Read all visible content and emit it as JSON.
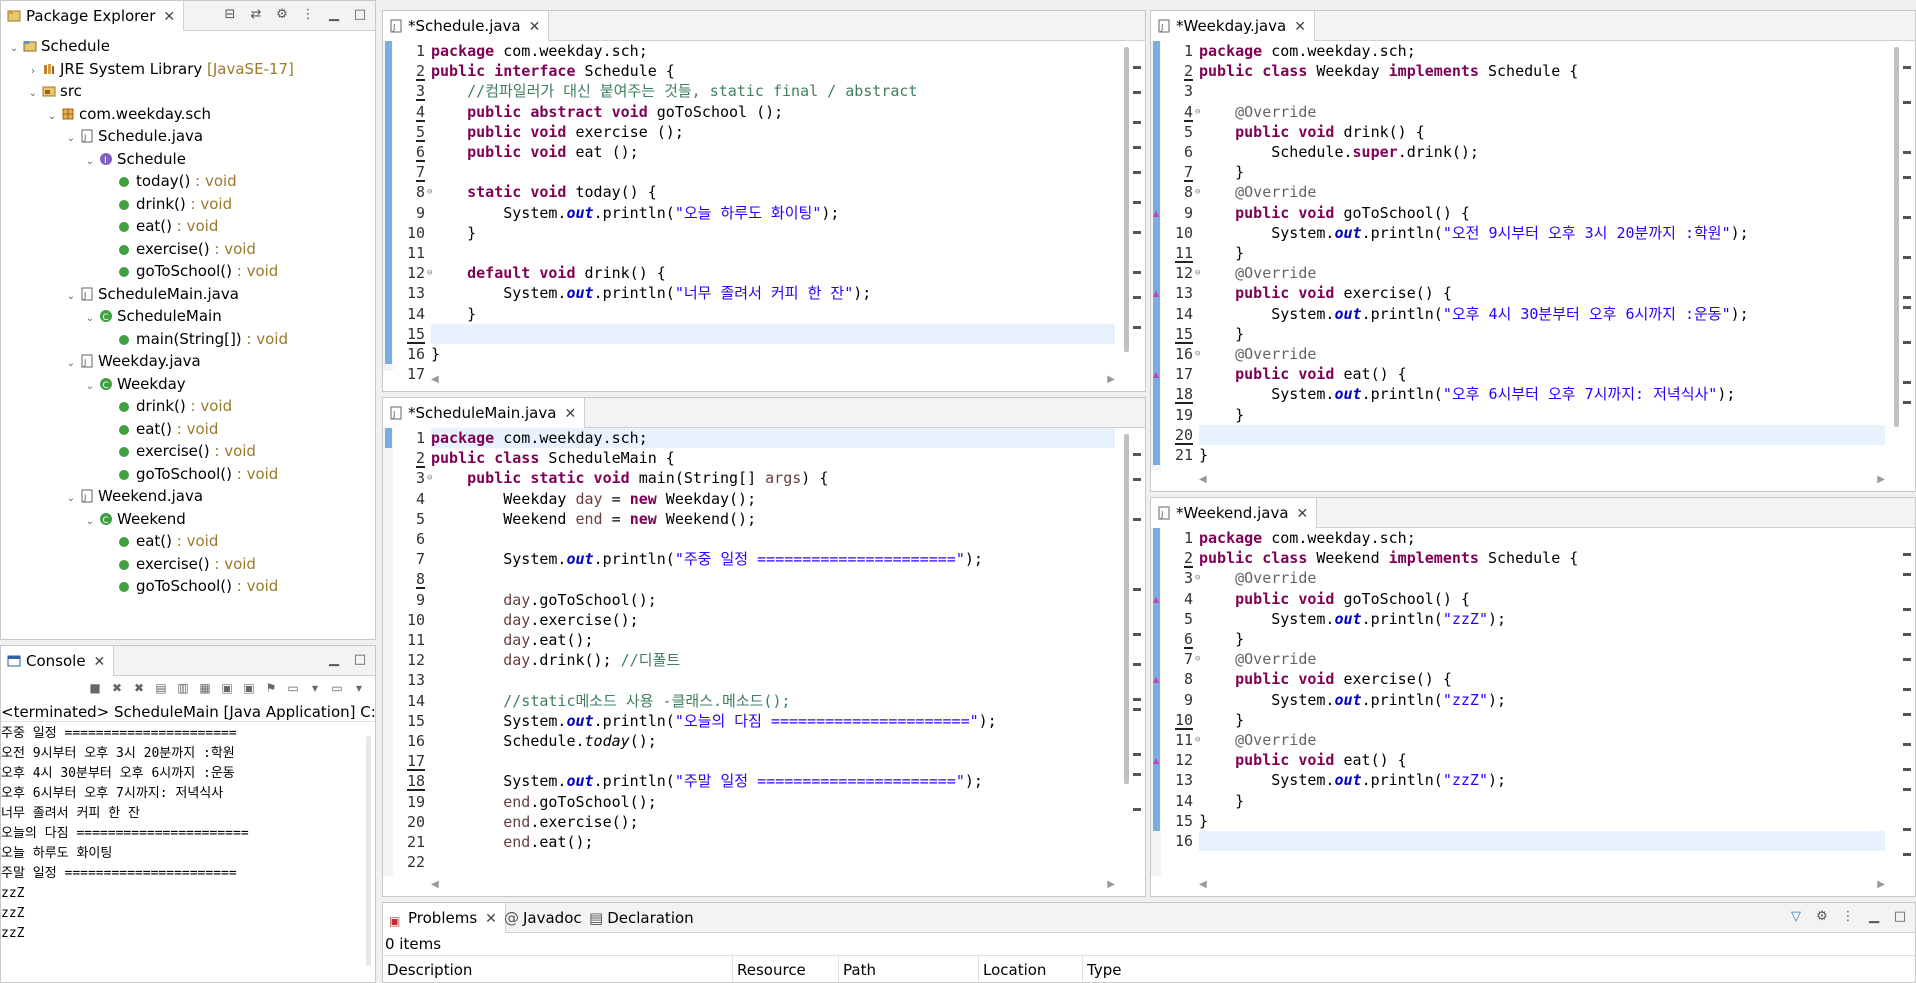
{
  "package_explorer": {
    "tab_label": "Package Explorer",
    "tree": [
      {
        "label": "Schedule",
        "suffix": "",
        "depth": 0,
        "twist": "v",
        "icon": "project-icon"
      },
      {
        "label": "JRE System Library",
        "suffix": " [JavaSE-17]",
        "depth": 1,
        "twist": ">",
        "icon": "library-icon"
      },
      {
        "label": "src",
        "suffix": "",
        "depth": 1,
        "twist": "v",
        "icon": "source-folder-icon"
      },
      {
        "label": "com.weekday.sch",
        "suffix": "",
        "depth": 2,
        "twist": "v",
        "icon": "package-icon"
      },
      {
        "label": "Schedule.java",
        "suffix": "",
        "depth": 3,
        "twist": "v",
        "icon": "java-file-icon"
      },
      {
        "label": "Schedule",
        "suffix": "",
        "depth": 4,
        "twist": "v",
        "icon": "interface-icon"
      },
      {
        "label": "today()",
        "suffix": " : void",
        "depth": 5,
        "twist": "",
        "icon": "method-icon"
      },
      {
        "label": "drink()",
        "suffix": " : void",
        "depth": 5,
        "twist": "",
        "icon": "method-icon"
      },
      {
        "label": "eat()",
        "suffix": " : void",
        "depth": 5,
        "twist": "",
        "icon": "method-icon"
      },
      {
        "label": "exercise()",
        "suffix": " : void",
        "depth": 5,
        "twist": "",
        "icon": "method-icon"
      },
      {
        "label": "goToSchool()",
        "suffix": " : void",
        "depth": 5,
        "twist": "",
        "icon": "method-icon"
      },
      {
        "label": "ScheduleMain.java",
        "suffix": "",
        "depth": 3,
        "twist": "v",
        "icon": "java-file-icon"
      },
      {
        "label": "ScheduleMain",
        "suffix": "",
        "depth": 4,
        "twist": "v",
        "icon": "class-icon"
      },
      {
        "label": "main(String[])",
        "suffix": " : void",
        "depth": 5,
        "twist": "",
        "icon": "method-icon"
      },
      {
        "label": "Weekday.java",
        "suffix": "",
        "depth": 3,
        "twist": "v",
        "icon": "java-file-icon"
      },
      {
        "label": "Weekday",
        "suffix": "",
        "depth": 4,
        "twist": "v",
        "icon": "class-icon"
      },
      {
        "label": "drink()",
        "suffix": " : void",
        "depth": 5,
        "twist": "",
        "icon": "method-icon"
      },
      {
        "label": "eat()",
        "suffix": " : void",
        "depth": 5,
        "twist": "",
        "icon": "method-icon"
      },
      {
        "label": "exercise()",
        "suffix": " : void",
        "depth": 5,
        "twist": "",
        "icon": "method-icon"
      },
      {
        "label": "goToSchool()",
        "suffix": " : void",
        "depth": 5,
        "twist": "",
        "icon": "method-icon"
      },
      {
        "label": "Weekend.java",
        "suffix": "",
        "depth": 3,
        "twist": "v",
        "icon": "java-file-icon"
      },
      {
        "label": "Weekend",
        "suffix": "",
        "depth": 4,
        "twist": "v",
        "icon": "class-icon"
      },
      {
        "label": "eat()",
        "suffix": " : void",
        "depth": 5,
        "twist": "",
        "icon": "method-icon"
      },
      {
        "label": "exercise()",
        "suffix": " : void",
        "depth": 5,
        "twist": "",
        "icon": "method-icon"
      },
      {
        "label": "goToSchool()",
        "suffix": " : void",
        "depth": 5,
        "twist": "",
        "icon": "method-icon"
      }
    ]
  },
  "console": {
    "tab_label": "Console",
    "status": "<terminated> ScheduleMain [Java Application] C:\\Use",
    "output": [
      "주중 일정 ======================",
      "오전 9시부터 오후 3시 20분까지 :학원",
      "오후 4시 30분부터 오후 6시까지 :운동",
      "오후 6시부터 오후 7시까지: 저녁식사",
      "너무 졸려서 커피 한 잔",
      "오늘의 다짐 ======================",
      "오늘 하루도 화이팅",
      "주말 일정 ======================",
      "zzZ",
      "zzZ",
      "zzZ"
    ]
  },
  "editors": {
    "schedule": {
      "tab_label": "*Schedule.java",
      "lines": [
        "<span class='kw'>package</span> com.weekday.sch;",
        "<span class='kw'>public interface</span> Schedule {",
        "    <span class='cm'>//컴파일러가 대신 붙여주는 것들, static final / abstract</span>",
        "    <span class='kw'>public abstract void</span> goToSchool ();",
        "    <span class='kw'>public void</span> exercise ();",
        "    <span class='kw'>public void</span> eat ();",
        "",
        "    <span class='kw'>static void</span> today() {",
        "        System.<span class='fld'>out</span>.println(<span class='str'>\"오늘 하루도 화이팅\"</span>);",
        "    }",
        "",
        "    <span class='kw'>default void</span> drink() {",
        "        System.<span class='fld'>out</span>.println(<span class='str'>\"너무 졸려서 커피 한 잔\"</span>);",
        "    }",
        "",
        "}",
        ""
      ]
    },
    "weekday": {
      "tab_label": "*Weekday.java",
      "lines": [
        "<span class='kw'>package</span> com.weekday.sch;",
        "<span class='kw'>public class</span> Weekday <span class='kw'>implements</span> Schedule {",
        "",
        "    <span class='an'>@Override</span>",
        "    <span class='kw'>public void</span> drink() {",
        "        Schedule.<span class='kw'>super</span>.drink();",
        "    }",
        "    <span class='an'>@Override</span>",
        "    <span class='kw'>public void</span> goToSchool() {",
        "        System.<span class='fld'>out</span>.println(<span class='str'>\"오전 9시부터 오후 3시 20분까지 :학원\"</span>);",
        "    }",
        "    <span class='an'>@Override</span>",
        "    <span class='kw'>public void</span> exercise() {",
        "        System.<span class='fld'>out</span>.println(<span class='str'>\"오후 4시 30분부터 오후 6시까지 :운동\"</span>);",
        "    }",
        "    <span class='an'>@Override</span>",
        "    <span class='kw'>public void</span> eat() {",
        "        System.<span class='fld'>out</span>.println(<span class='str'>\"오후 6시부터 오후 7시까지: 저녁식사\"</span>);",
        "    }",
        "",
        "}"
      ]
    },
    "schedule_main": {
      "tab_label": "*ScheduleMain.java",
      "lines": [
        "<span class='kw'>package</span> com.weekday.sch;",
        "<span class='kw'>public class</span> ScheduleMain {",
        "    <span class='kw'>public static void</span> main(String[] <span class='var'>args</span>) {",
        "        Weekday <span class='var'>day</span> = <span class='kw'>new</span> Weekday();",
        "        Weekend <span class='var'>end</span> = <span class='kw'>new</span> Weekend();",
        "",
        "        System.<span class='fld'>out</span>.println(<span class='str'>\"주중 일정 ======================\"</span>);",
        "",
        "        <span class='var'>day</span>.goToSchool();",
        "        <span class='var'>day</span>.exercise();",
        "        <span class='var'>day</span>.eat();",
        "        <span class='var'>day</span>.drink(); <span class='cm'>//디폴트</span>",
        "",
        "        <span class='cm'>//static메소드 사용 -클래스.메소드();</span>",
        "        System.<span class='fld'>out</span>.println(<span class='str'>\"오늘의 다짐 ======================\"</span>);",
        "        Schedule.<span class='it'>today</span>();",
        "",
        "        System.<span class='fld'>out</span>.println(<span class='str'>\"주말 일정 ======================\"</span>);",
        "        <span class='var'>end</span>.goToSchool();",
        "        <span class='var'>end</span>.exercise();",
        "        <span class='var'>end</span>.eat();",
        ""
      ]
    },
    "weekend": {
      "tab_label": "*Weekend.java",
      "lines": [
        "<span class='kw'>package</span> com.weekday.sch;",
        "<span class='kw'>public class</span> Weekend <span class='kw'>implements</span> Schedule {",
        "    <span class='an'>@Override</span>",
        "    <span class='kw'>public void</span> goToSchool() {",
        "        System.<span class='fld'>out</span>.println(<span class='str'>\"zzZ\"</span>);",
        "    }",
        "    <span class='an'>@Override</span>",
        "    <span class='kw'>public void</span> exercise() {",
        "        System.<span class='fld'>out</span>.println(<span class='str'>\"zzZ\"</span>);",
        "    }",
        "    <span class='an'>@Override</span>",
        "    <span class='kw'>public void</span> eat() {",
        "        System.<span class='fld'>out</span>.println(<span class='str'>\"zzZ\"</span>);",
        "    }",
        "}",
        ""
      ]
    }
  },
  "problems": {
    "tabs": [
      "Problems",
      "Javadoc",
      "Declaration"
    ],
    "count": "0 items",
    "columns": [
      "Description",
      "Resource",
      "Path",
      "Location",
      "Type"
    ]
  },
  "colors": {
    "keyword": "#7f0055",
    "string": "#2a00ff",
    "comment": "#3f7f5f",
    "field": "#0000c0",
    "current_line": "#e8f2fe"
  }
}
